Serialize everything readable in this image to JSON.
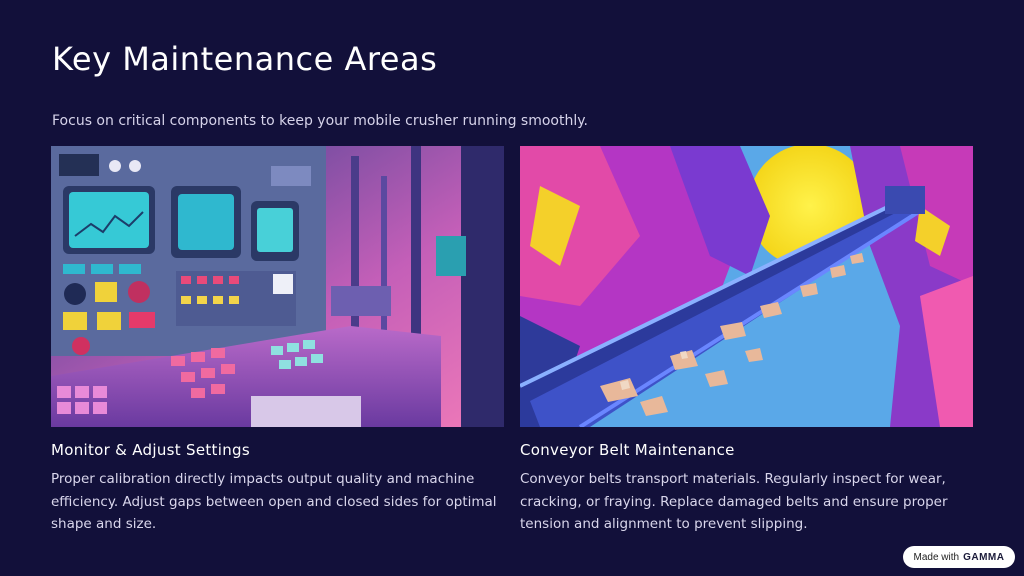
{
  "title": "Key Maintenance Areas",
  "subtitle": "Focus on critical components to keep your mobile crusher running smoothly.",
  "cards": [
    {
      "heading": "Monitor & Adjust Settings",
      "body": "Proper calibration directly impacts output quality and machine efficiency. Adjust gaps between open and closed sides for optimal shape and size.",
      "image": "control-panel-illustration"
    },
    {
      "heading": "Conveyor Belt Maintenance",
      "body": "Conveyor belts transport materials. Regularly inspect for wear, cracking, or fraying. Replace damaged belts and ensure proper tension and alignment to prevent slipping.",
      "image": "conveyor-belt-illustration"
    }
  ],
  "badge": {
    "prefix": "Made with",
    "brand": "GAMMA"
  }
}
